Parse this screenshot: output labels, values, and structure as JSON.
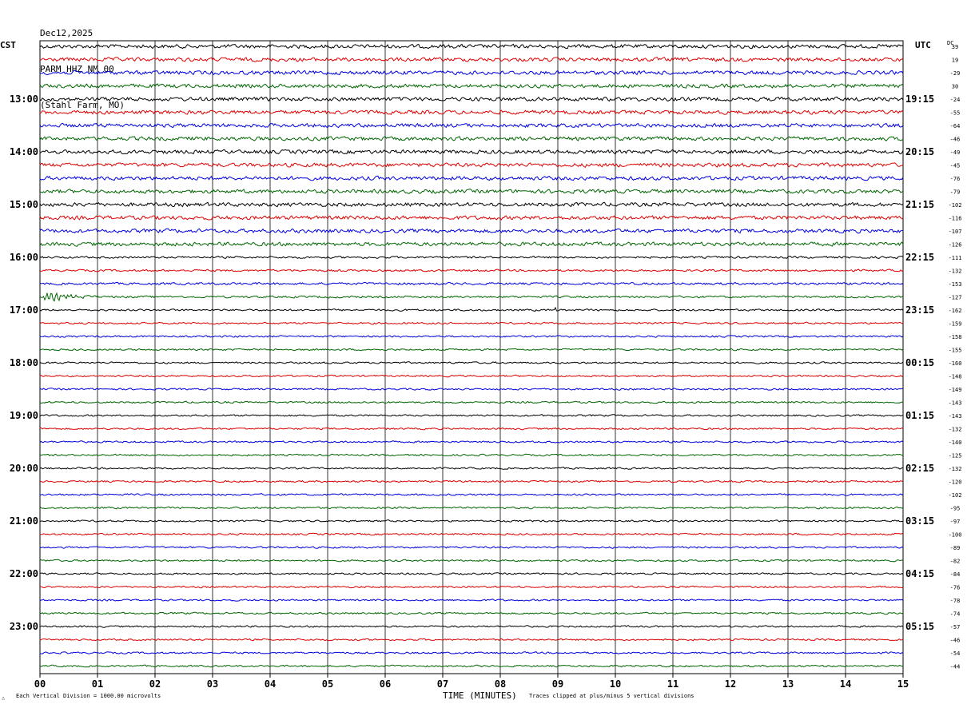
{
  "header": {
    "date": "Dec12,2025",
    "station": "PARM HHZ NM 00",
    "location": "(Stahl Farm, MO)"
  },
  "left_axis_label": "CST",
  "right_axis_label": "UTC",
  "dc_label": "DC",
  "footer": {
    "scale_note": "Each Vertical Division = 1000.00 microvolts",
    "x_title": "TIME (MINUTES)",
    "clip_note": "Traces clipped at plus/minus 5 vertical divisions",
    "corner_mark": "∴"
  },
  "chart_data": {
    "type": "line",
    "x_ticks": [
      "00",
      "01",
      "02",
      "03",
      "04",
      "05",
      "06",
      "07",
      "08",
      "09",
      "10",
      "11",
      "12",
      "13",
      "14",
      "15"
    ],
    "xlim": [
      0,
      15
    ],
    "xlabel": "TIME (MINUTES)",
    "grid": true,
    "trace_colors": [
      "#000000",
      "#dd0000",
      "#0000dd",
      "#006600"
    ],
    "left_hour_labels": [
      "13:00",
      "14:00",
      "15:00",
      "16:00",
      "17:00",
      "18:00",
      "19:00",
      "20:00",
      "21:00",
      "22:00",
      "23:00"
    ],
    "right_hour_labels": [
      "19:15",
      "20:15",
      "21:15",
      "22:15",
      "23:15",
      "00:15",
      "01:15",
      "02:15",
      "03:15",
      "04:15",
      "05:15"
    ],
    "dc_offsets": [
      39,
      19,
      -29,
      30,
      -24,
      -55,
      -64,
      -46,
      -49,
      -45,
      -76,
      -79,
      -102,
      -116,
      -107,
      -126,
      -111,
      -132,
      -153,
      -127,
      -162,
      -159,
      -158,
      -155,
      -160,
      -148,
      -149,
      -143,
      -143,
      -132,
      -140,
      -125,
      -132,
      -120,
      -102,
      -95,
      -97,
      -100,
      -89,
      -82,
      -84,
      -76,
      -78,
      -74,
      -57,
      -46,
      -54,
      -44
    ],
    "trace_amplitude": [
      3,
      3,
      3,
      3,
      3,
      3,
      3,
      3,
      3,
      3,
      3,
      3,
      3,
      3,
      3,
      3,
      1.6,
      1.6,
      1.8,
      1.6,
      1.5,
      1.4,
      1.4,
      1.4,
      1.4,
      1.4,
      1.4,
      1.4,
      1.4,
      1.4,
      1.4,
      1.4,
      1.4,
      1.4,
      1.4,
      1.4,
      1.4,
      1.4,
      1.4,
      1.4,
      1.4,
      1.4,
      1.4,
      1.4,
      1.4,
      1.4,
      1.4,
      1.4
    ],
    "events": [
      {
        "trace": 19,
        "start_min": 0.05,
        "end_min": 2.5,
        "peak": 9
      },
      {
        "trace": 20,
        "start_min": 8.95,
        "end_min": 9.2,
        "peak": 6
      }
    ]
  }
}
